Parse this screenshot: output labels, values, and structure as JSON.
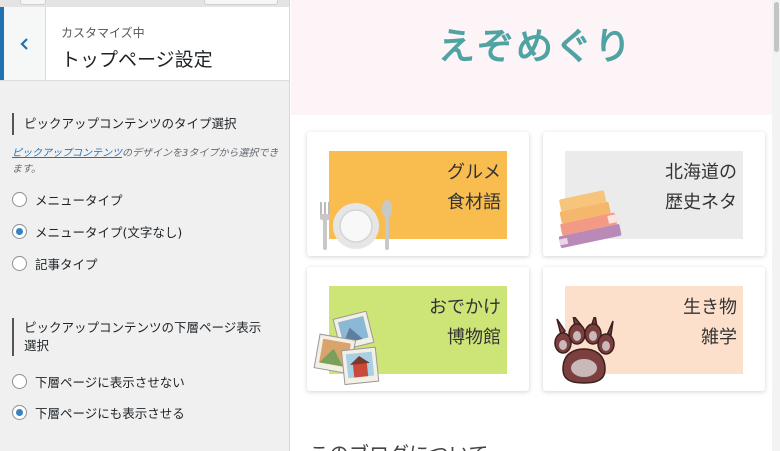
{
  "panel": {
    "subtitle": "カスタマイズ中",
    "title": "トップページ設定",
    "section1": {
      "title": "ピックアップコンテンツのタイプ選択",
      "desc_link": "ピックアップコンテンツ",
      "desc_rest": "のデザインを3タイプから選択できます。",
      "options": [
        {
          "label": "メニュータイプ",
          "checked": false
        },
        {
          "label": "メニュータイプ(文字なし)",
          "checked": true
        },
        {
          "label": "記事タイプ",
          "checked": false
        }
      ]
    },
    "section2": {
      "title_line1": "ピックアップコンテンツの下層ページ表示",
      "title_line2": "選択",
      "options": [
        {
          "label": "下層ページに表示させない",
          "checked": false
        },
        {
          "label": "下層ページにも表示させる",
          "checked": true
        }
      ]
    }
  },
  "preview": {
    "site_title": "えぞめぐり",
    "cards": [
      {
        "line1": "グルメ",
        "line2": "食材語",
        "bg": "#f9bd4f",
        "icon": "plate-fork-knife-icon"
      },
      {
        "line1": "北海道の",
        "line2": "歴史ネタ",
        "bg": "#ebebeb",
        "icon": "books-icon"
      },
      {
        "line1": "おでかけ",
        "line2": "博物館",
        "bg": "#cde477",
        "icon": "photos-icon"
      },
      {
        "line1": "生き物",
        "line2": "雑学",
        "bg": "#fde0cc",
        "icon": "paw-icon"
      }
    ],
    "about_heading": "このブログについて"
  }
}
